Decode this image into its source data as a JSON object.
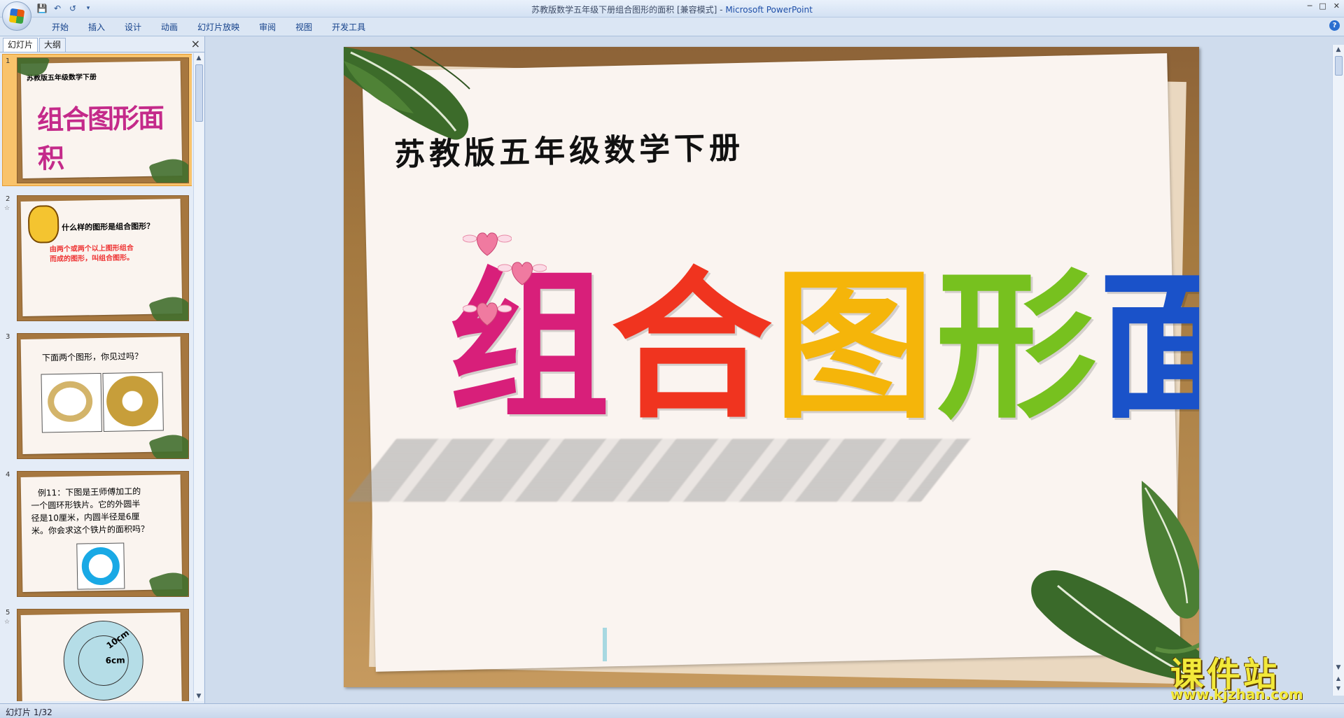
{
  "window": {
    "title": "苏教版数学五年级下册组合图形的面积 [兼容模式] - ",
    "app_name": "Microsoft PowerPoint"
  },
  "quick_access": {
    "save_icon": "save-icon",
    "undo_icon": "undo-icon",
    "redo_icon": "redo-icon"
  },
  "ribbon": {
    "tabs": [
      "开始",
      "插入",
      "设计",
      "动画",
      "幻灯片放映",
      "审阅",
      "视图",
      "开发工具"
    ]
  },
  "left_panel": {
    "tabs": [
      "幻灯片",
      "大纲"
    ],
    "thumbnails": [
      {
        "number": "1",
        "line1": "苏教版五年级数学下册",
        "line2": "组合图形面积"
      },
      {
        "number": "2",
        "line1": "什么样的图形是组合图形？",
        "line2": "由两个或两个以上图形组合",
        "line3": "而成的图形，叫组合图形。"
      },
      {
        "number": "3",
        "line1": "下面两个图形，你见过吗？"
      },
      {
        "number": "4",
        "line1": "例11：下图是王师傅加工的",
        "line2": "一个圆环形铁片。它的外圆半",
        "line3": "径是10厘米，内圆半径是6厘",
        "line4": "米。你会求这个铁片的面积吗？"
      },
      {
        "number": "5",
        "label_outer": "10cm",
        "label_inner": "6cm"
      }
    ]
  },
  "slide": {
    "subtitle": "苏教版五年级数学下册",
    "title_chars": [
      {
        "char": "组",
        "color": "#d81f7a"
      },
      {
        "char": "合",
        "color": "#f0341f"
      },
      {
        "char": "图",
        "color": "#f5b50a"
      },
      {
        "char": "形",
        "color": "#77c11f"
      },
      {
        "char": "面",
        "color": "#1a52c9"
      },
      {
        "char": "积",
        "color": "#7a1fc4"
      }
    ]
  },
  "watermark": {
    "text": "课件站",
    "url": "www.kjzhan.com"
  },
  "status": {
    "text": "幻灯片 1/32"
  }
}
